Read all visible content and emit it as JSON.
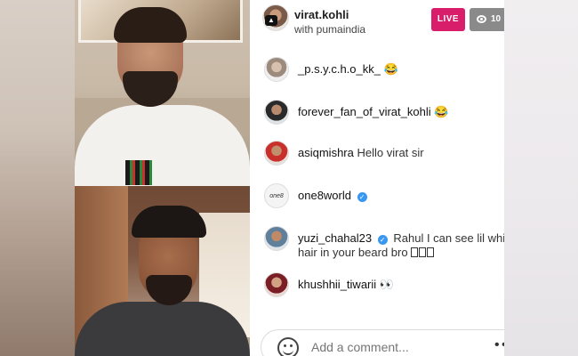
{
  "header": {
    "host_name": "virat.kohli",
    "host_subtitle": "with pumaindia",
    "live_label": "LIVE",
    "viewer_count": "10"
  },
  "comments": [
    {
      "username": "_p.s.y.c.h.o_kk_",
      "text": "",
      "emoji": "😂",
      "verified": false
    },
    {
      "username": "forever_fan_of_virat_kohli",
      "text": "",
      "emoji": "😂",
      "verified": false
    },
    {
      "username": "asiqmishra",
      "text": "Hello virat sir",
      "emoji": "",
      "verified": false
    },
    {
      "username": "one8world",
      "text": "",
      "emoji": "",
      "verified": true
    },
    {
      "username": "yuzi_chahal23",
      "text": "Rahul I can see lil whit",
      "text_line2": "hair in your beard bro",
      "emoji": "",
      "verified": true
    },
    {
      "username": "khushhii_tiwarii",
      "text": "",
      "emoji": "👀",
      "verified": false
    }
  ],
  "composer": {
    "placeholder": "Add a comment..."
  },
  "colors": {
    "live_badge": "#d81e6b",
    "viewer_badge": "#8a8a8a",
    "verified": "#3897f0"
  },
  "icons": [
    "eye-icon",
    "verified-icon",
    "smile-icon",
    "more-icon"
  ]
}
